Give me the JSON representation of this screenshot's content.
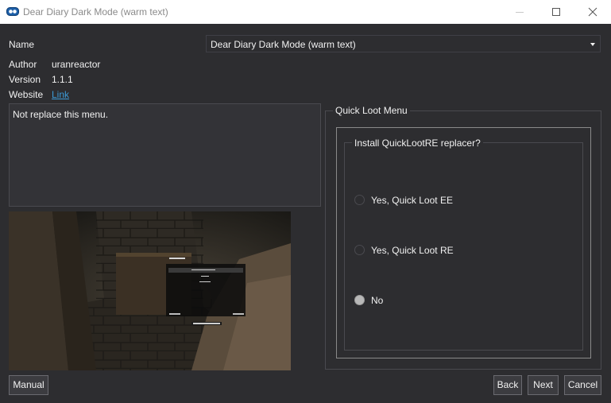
{
  "window": {
    "title": "Dear Diary Dark Mode (warm text)"
  },
  "form": {
    "name_label": "Name",
    "name_value": "Dear Diary Dark Mode (warm text)",
    "author_label": "Author",
    "author_value": "uranreactor",
    "version_label": "Version",
    "version_value": "1.1.1",
    "website_label": "Website",
    "website_link": "Link"
  },
  "description": "Not replace this menu.",
  "quickloot": {
    "group_title": "Quick Loot Menu",
    "question": "Install QuickLootRE replacer?",
    "options": [
      {
        "label": "Yes, Quick Loot EE",
        "checked": false
      },
      {
        "label": "Yes, Quick Loot RE",
        "checked": false
      },
      {
        "label": "No",
        "checked": true
      }
    ]
  },
  "buttons": {
    "manual": "Manual",
    "back": "Back",
    "next": "Next",
    "cancel": "Cancel"
  },
  "colors": {
    "background": "#2d2d30",
    "link": "#3c9ad6",
    "titlebar": "#ffffff"
  }
}
